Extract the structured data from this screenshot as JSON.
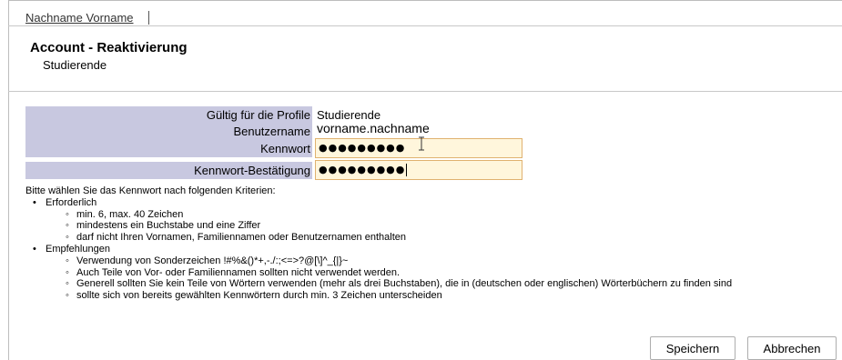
{
  "header": {
    "user_name": "Nachname Vorname"
  },
  "page": {
    "title": "Account - Reaktivierung",
    "subtitle": "Studierende"
  },
  "form": {
    "profile_label": "Gültig für die Profile",
    "profile_value": "Studierende",
    "username_label": "Benutzername",
    "username_value": "vorname.nachname",
    "password_label": "Kennwort",
    "password_value": "●●●●●●●●●",
    "password_confirm_label": "Kennwort-Bestätigung",
    "password_confirm_value": "●●●●●●●●●"
  },
  "criteria": {
    "intro": "Bitte wählen Sie das Kennwort nach folgenden Kriterien:",
    "groups": [
      {
        "title": "Erforderlich",
        "items": [
          "min. 6, max. 40 Zeichen",
          "mindestens ein Buchstabe und eine Ziffer",
          "darf nicht Ihren Vornamen, Familiennamen oder Benutzernamen enthalten"
        ]
      },
      {
        "title": "Empfehlungen",
        "items": [
          "Verwendung von Sonderzeichen !#%&()*+,-./:;<=>?@[\\]^_{|}~",
          "Auch Teile von Vor- oder Familiennamen sollten nicht verwendet werden.",
          "Generell sollten Sie kein Teile von Wörtern verwenden (mehr als drei Buchstaben), die in (deutschen oder englischen) Wörterbüchern zu finden sind",
          "sollte sich von bereits gewählten Kennwörtern durch min. 3 Zeichen unterscheiden"
        ]
      }
    ]
  },
  "buttons": {
    "save": "Speichern",
    "cancel": "Abbrechen"
  }
}
